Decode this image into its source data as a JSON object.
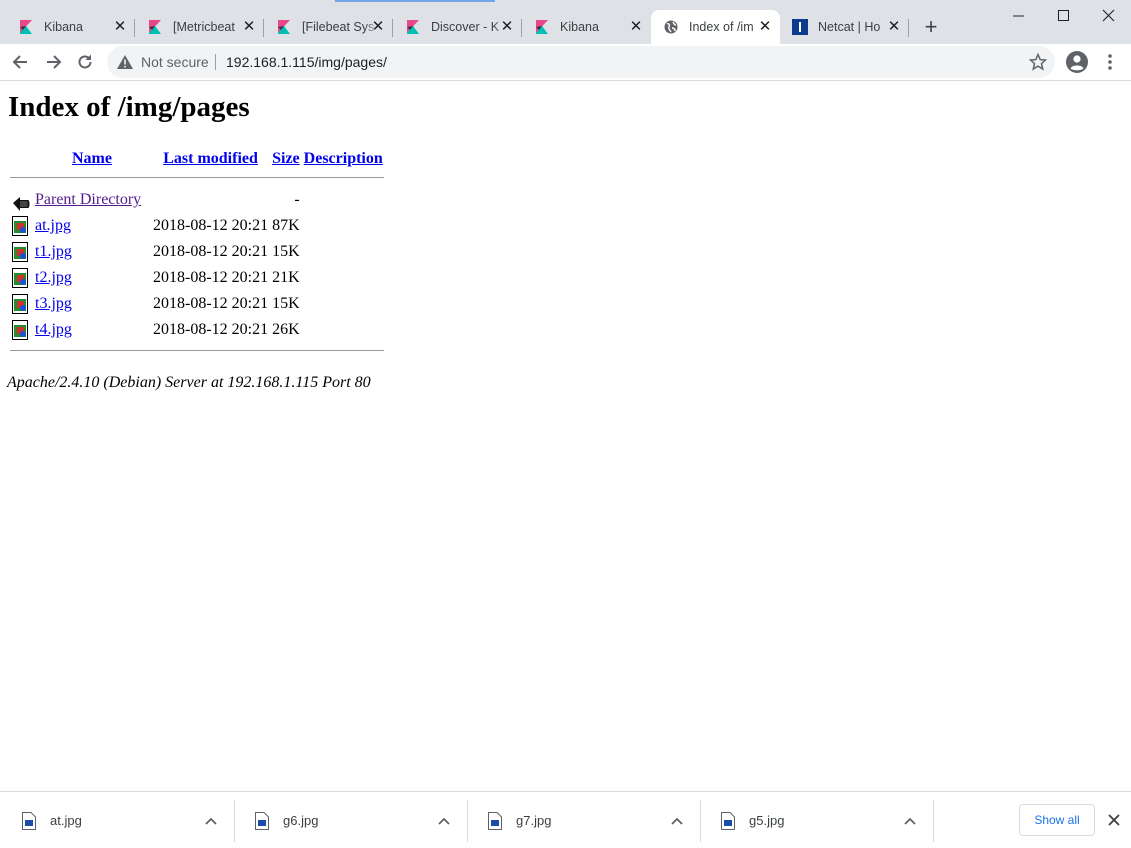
{
  "browser": {
    "tabs": [
      {
        "title": "Kibana",
        "favicon": "kibana-icon"
      },
      {
        "title": "[Metricbeat",
        "favicon": "kibana-icon"
      },
      {
        "title": "[Filebeat Sys",
        "favicon": "kibana-icon"
      },
      {
        "title": "Discover - K",
        "favicon": "kibana-icon"
      },
      {
        "title": "Kibana",
        "favicon": "kibana-icon"
      },
      {
        "title": "Index of /im",
        "favicon": "globe-icon",
        "active": true
      },
      {
        "title": "Netcat | Ho",
        "favicon": "netcat-icon"
      }
    ],
    "security_label": "Not secure",
    "url": "192.168.1.115/img/pages/",
    "colors": {
      "tabstrip": "#dee1e6",
      "accent": "#1a73e8",
      "link": "#0000ee",
      "visited": "#551a8b"
    }
  },
  "page": {
    "title": "Index of /img/pages",
    "headers": {
      "name": "Name",
      "modified": "Last modified",
      "size": "Size",
      "description": "Description"
    },
    "parent": {
      "name": "Parent Directory",
      "size": "-"
    },
    "files": [
      {
        "name": "at.jpg",
        "modified": "2018-08-12 20:21",
        "size": "87K"
      },
      {
        "name": "t1.jpg",
        "modified": "2018-08-12 20:21",
        "size": "15K"
      },
      {
        "name": "t2.jpg",
        "modified": "2018-08-12 20:21",
        "size": "21K"
      },
      {
        "name": "t3.jpg",
        "modified": "2018-08-12 20:21",
        "size": "15K"
      },
      {
        "name": "t4.jpg",
        "modified": "2018-08-12 20:21",
        "size": "26K"
      }
    ],
    "address": "Apache/2.4.10 (Debian) Server at 192.168.1.115 Port 80"
  },
  "downloads": {
    "items": [
      "at.jpg",
      "g6.jpg",
      "g7.jpg",
      "g5.jpg"
    ],
    "show_all": "Show all"
  }
}
